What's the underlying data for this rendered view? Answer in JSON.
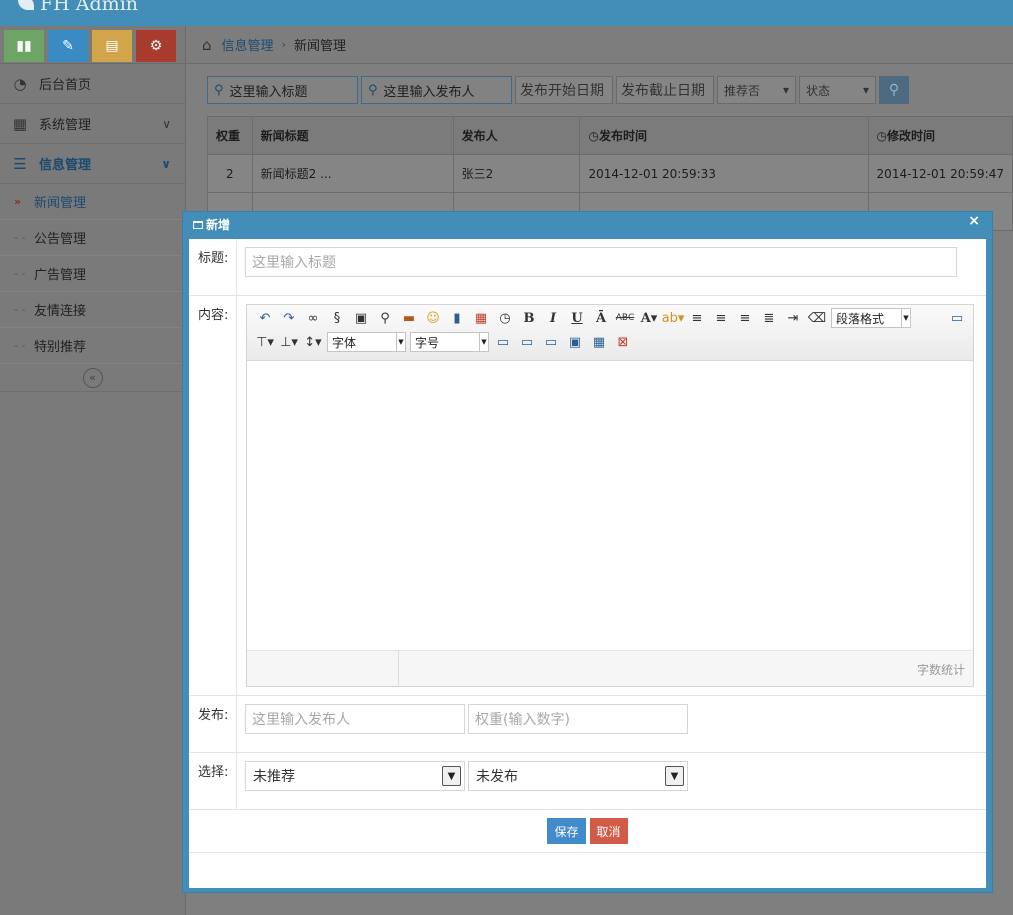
{
  "app": {
    "brand": "FH Admin"
  },
  "shortcuts": [
    {
      "icon": "signal-icon",
      "glyph": "▮",
      "color": "#6ea465"
    },
    {
      "icon": "pencil-icon",
      "glyph": "✎",
      "color": "#3a8bc4"
    },
    {
      "icon": "book-icon",
      "glyph": "▤",
      "color": "#d2a54a"
    },
    {
      "icon": "cogs-icon",
      "glyph": "⚙",
      "color": "#a83a2e"
    }
  ],
  "sidebar": {
    "items": [
      {
        "label": "后台首页"
      },
      {
        "label": "系统管理"
      },
      {
        "label": "信息管理"
      }
    ],
    "sub_items": [
      {
        "label": "新闻管理"
      },
      {
        "label": "公告管理"
      },
      {
        "label": "广告管理"
      },
      {
        "label": "友情连接"
      },
      {
        "label": "特别推荐"
      }
    ]
  },
  "breadcrumb": {
    "parent": "信息管理",
    "current": "新闻管理"
  },
  "search": {
    "title_placeholder": "这里输入标题",
    "publisher_placeholder": "这里输入发布人",
    "start_date": "发布开始日期",
    "end_date": "发布截止日期",
    "recommend": "推荐否",
    "status": "状态"
  },
  "table": {
    "headers": [
      "权重",
      "新闻标题",
      "发布人",
      "发布时间",
      "修改时间"
    ],
    "rows": [
      [
        "2",
        "新闻标题2 ...",
        "张三2",
        "2014-12-01 20:59:33",
        "2014-12-01 20:59:47"
      ]
    ]
  },
  "dialog": {
    "title": "新增",
    "close": "×",
    "labels": {
      "title": "标题:",
      "content": "内容:",
      "publish": "发布:",
      "select": "选择:"
    },
    "title_placeholder": "这里输入标题",
    "publisher_placeholder": "这里输入发布人",
    "weight_placeholder": "权重(输入数字)",
    "recommend_value": "未推荐",
    "status_value": "未发布",
    "editor": {
      "paragraph_format": "段落格式",
      "font_family": "字体",
      "font_size": "字号",
      "word_count": "字数统计"
    },
    "save_label": "保存",
    "cancel_label": "取消"
  }
}
